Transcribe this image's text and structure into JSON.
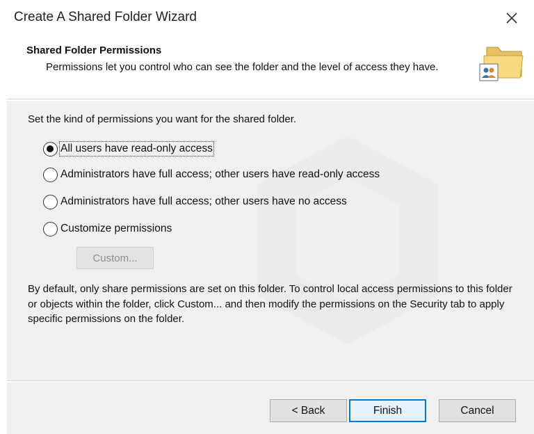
{
  "window": {
    "title": "Create A Shared Folder Wizard",
    "close_icon": "close-icon"
  },
  "header": {
    "title": "Shared Folder Permissions",
    "subtitle": "Permissions let you control who can see the folder and the level of access they have.",
    "icon": "shared-folder-icon"
  },
  "content": {
    "prompt": "Set the kind of permissions you want for the shared folder.",
    "options": [
      {
        "label": "All users have read-only access",
        "checked": true
      },
      {
        "label": "Administrators have full access; other users have read-only access",
        "checked": false
      },
      {
        "label": "Administrators have full access; other users have no access",
        "checked": false
      },
      {
        "label": "Customize permissions",
        "checked": false
      }
    ],
    "custom_button": "Custom...",
    "info": "By default, only share permissions are set on this folder. To control local access permissions to this folder or objects within the folder, click Custom... and then modify the permissions on the Security tab to apply specific permissions on the folder."
  },
  "footer": {
    "back_label": "< Back",
    "finish_label": "Finish",
    "cancel_label": "Cancel"
  },
  "colors": {
    "accent": "#0078d7",
    "panel_bg": "#f0f0f0",
    "disabled_text": "#8e8e8e"
  }
}
